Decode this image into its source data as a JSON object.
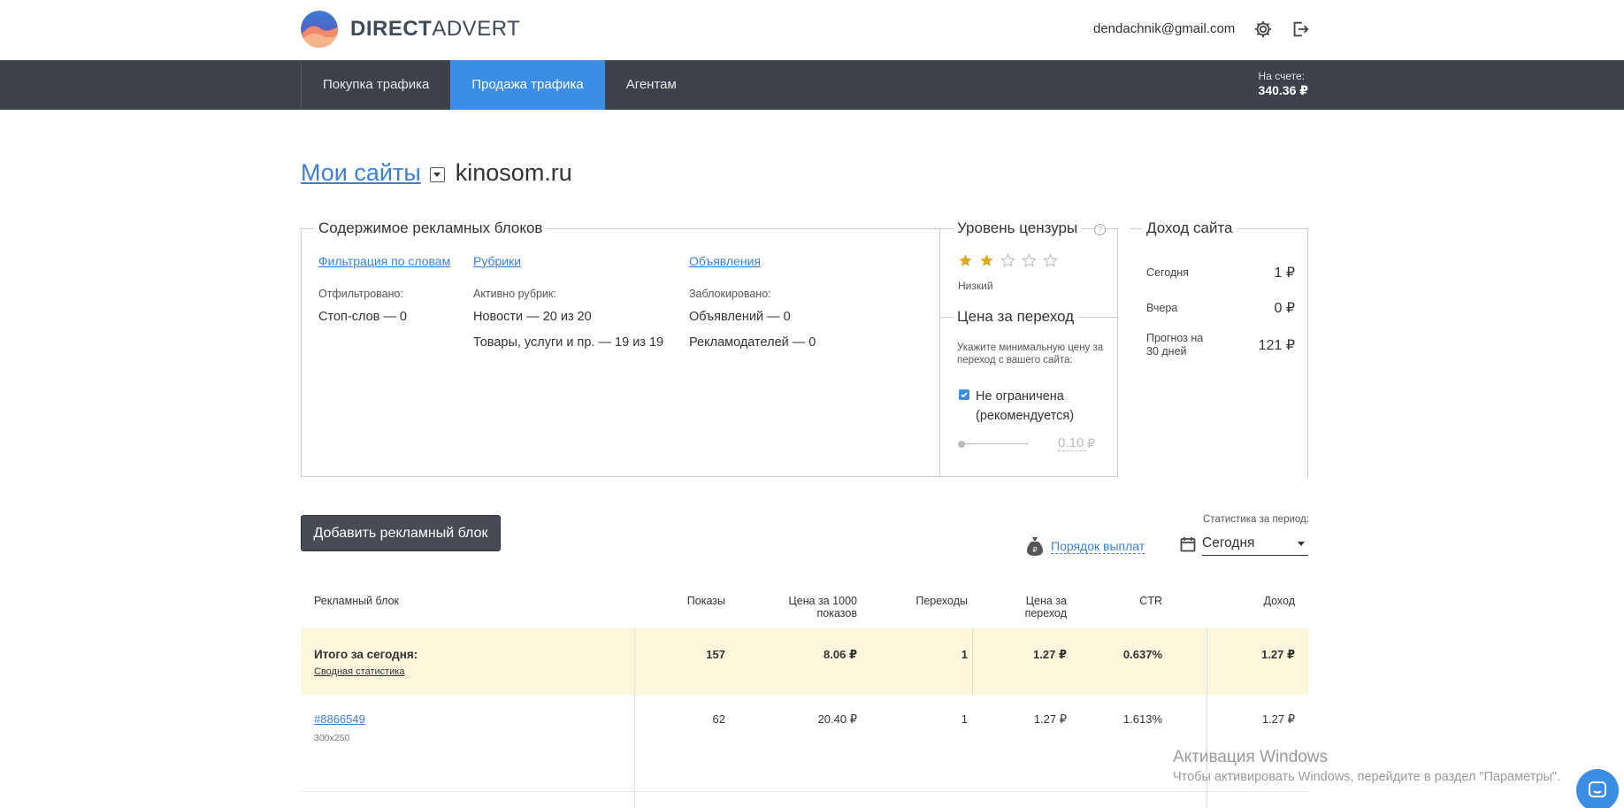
{
  "header": {
    "logo_bold": "DIRECT",
    "logo_light": "ADVERT",
    "user_email": "dendachnik@gmail.com",
    "icons": [
      "gear-icon",
      "logout-icon"
    ]
  },
  "nav": {
    "items": [
      {
        "label": "Покупка трафика",
        "active": false
      },
      {
        "label": "Продажа трафика",
        "active": true
      },
      {
        "label": "Агентам",
        "active": false
      }
    ],
    "balance_label": "На счете:",
    "balance_value": "340.36 ₽"
  },
  "breadcrumb": {
    "link": "Мои сайты",
    "site": "kinosom.ru"
  },
  "content_blocks": {
    "title": "Содержимое рекламных блоков",
    "columns": [
      {
        "link": "Фильтрация по словам",
        "label": "Отфильтровано:",
        "values": [
          "Стоп-слов — 0"
        ]
      },
      {
        "link": "Рубрики",
        "label": "Активно рубрик:",
        "values": [
          "Новости — 20 из 20",
          "Товары, услуги и пр. — 19 из 19"
        ]
      },
      {
        "link": "Объявления",
        "label": "Заблокировано:",
        "values": [
          "Объявлений — 0",
          "Рекламодателей — 0"
        ]
      }
    ]
  },
  "censor": {
    "title": "Уровень цензуры",
    "help": "?",
    "rating": 2,
    "max_rating": 5,
    "level": "Низкий"
  },
  "price": {
    "title": "Цена за переход",
    "description": "Укажите минимальную цену за переход с вашего сайта:",
    "checkbox_label": "Не ограничена (рекомендуется)",
    "checked": true,
    "value": "0.10",
    "currency": "₽"
  },
  "income": {
    "title": "Доход сайта",
    "rows": [
      {
        "label": "Сегодня",
        "value": "1 ₽"
      },
      {
        "label": "Вчера",
        "value": "0 ₽"
      },
      {
        "label": "Прогноз на 30 дней",
        "value": "121 ₽"
      }
    ]
  },
  "actions": {
    "add_block": "Добавить рекламный блок",
    "payout_link": "Порядок выплат",
    "period_label": "Статистика за период:",
    "period_value": "Сегодня"
  },
  "table": {
    "headers": [
      "Рекламный блок",
      "Показы",
      "Цена за 1000 показов",
      "Переходы",
      "Цена за переход",
      "CTR",
      "Доход"
    ],
    "total": {
      "title": "Итого за сегодня:",
      "link": "Сводная статистика",
      "impressions": "157",
      "cpm": "8.06 ₽",
      "clicks": "1",
      "cpc": "1.27 ₽",
      "ctr": "0.637%",
      "income": "1.27 ₽"
    },
    "rows": [
      {
        "id": "#8866549",
        "size": "300x250",
        "impressions": "62",
        "cpm": "20.40 ₽",
        "clicks": "1",
        "cpc": "1.27 ₽",
        "ctr": "1.613%",
        "income": "1.27 ₽"
      }
    ]
  },
  "watermark": {
    "title": "Активация Windows",
    "subtitle": "Чтобы активировать Windows, перейдите в раздел \"Параметры\"."
  },
  "colors": {
    "accent": "#3b8de6",
    "nav_bg": "#3c414c",
    "total_row_bg": "#fdf6dc",
    "star": "#e0a81e"
  }
}
